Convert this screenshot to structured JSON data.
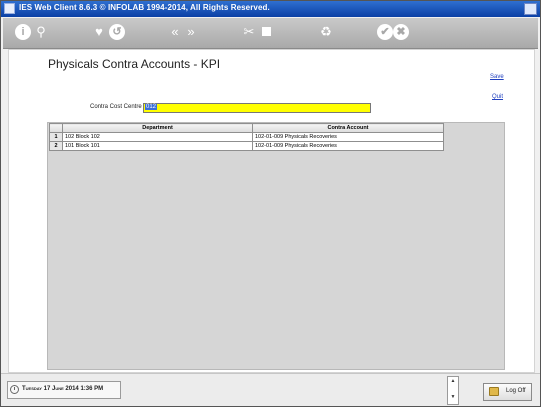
{
  "window": {
    "title": "IES Web Client 8.6.3 © INFOLAB 1994-2014, All Rights Reserved."
  },
  "toolbar": {
    "icons": [
      "info-icon",
      "search-icon",
      "heart-icon",
      "refresh-icon",
      "prev-icon",
      "next-icon",
      "tools-icon",
      "stop-icon",
      "recycle-icon",
      "check-icon",
      "cancel-icon"
    ],
    "info_glyph": "i",
    "search_glyph": "⚲",
    "heart_glyph": "♥",
    "refresh_glyph": "↺",
    "prev_glyph": "«",
    "next_glyph": "»",
    "tools_glyph": "✂",
    "recycle_glyph": "♻",
    "check_glyph": "✔",
    "cancel_glyph": "✖"
  },
  "page": {
    "title": "Physicals Contra Accounts - KPI",
    "save_label": "Save",
    "quit_label": "Quit"
  },
  "form": {
    "contra_cost_centre_label": "Contra Cost Centre",
    "contra_cost_centre_value": "012"
  },
  "grid": {
    "columns": [
      "Department",
      "Contra Account"
    ],
    "rows": [
      {
        "num": "1",
        "department": "102 Block 102",
        "contra_account": "102-01-009 Physicals Recoveries"
      },
      {
        "num": "2",
        "department": "101 Block 101",
        "contra_account": "102-01-009 Physicals Recoveries"
      }
    ]
  },
  "status": {
    "datetime": "Tuesday 17 June 2014 1:36 PM",
    "logoff_label": "Log Off"
  },
  "colors": {
    "titlebar": "#0b3fa5",
    "input_highlight": "#ffff00",
    "link": "#1f3fbf"
  }
}
